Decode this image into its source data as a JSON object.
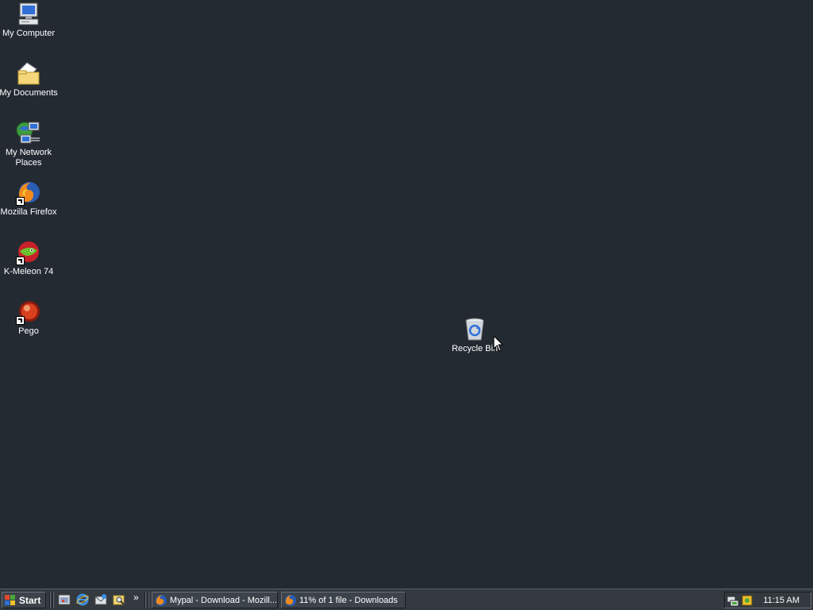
{
  "desktop": {
    "icons": [
      {
        "label": "My Computer",
        "icon": "my-computer-icon"
      },
      {
        "label": "My Documents",
        "icon": "my-documents-icon"
      },
      {
        "label": "My Network Places",
        "icon": "network-places-icon"
      },
      {
        "label": "Mozilla Firefox",
        "icon": "firefox-icon"
      },
      {
        "label": "K-Meleon 74",
        "icon": "k-meleon-icon"
      },
      {
        "label": "Pego",
        "icon": "pego-icon"
      },
      {
        "label": "Recycle Bin",
        "icon": "recycle-bin-icon"
      }
    ]
  },
  "taskbar": {
    "start_label": "Start",
    "overflow_chevron": "»",
    "tasks": [
      {
        "label": "Mypal - Download - Mozill...",
        "icon": "mypal-icon"
      },
      {
        "label": "11% of 1 file - Downloads",
        "icon": "firefox-download-icon"
      }
    ],
    "clock": "11:15 AM"
  },
  "colors": {
    "desktop_background": "#242a32",
    "taskbar_background": "#33393f"
  }
}
